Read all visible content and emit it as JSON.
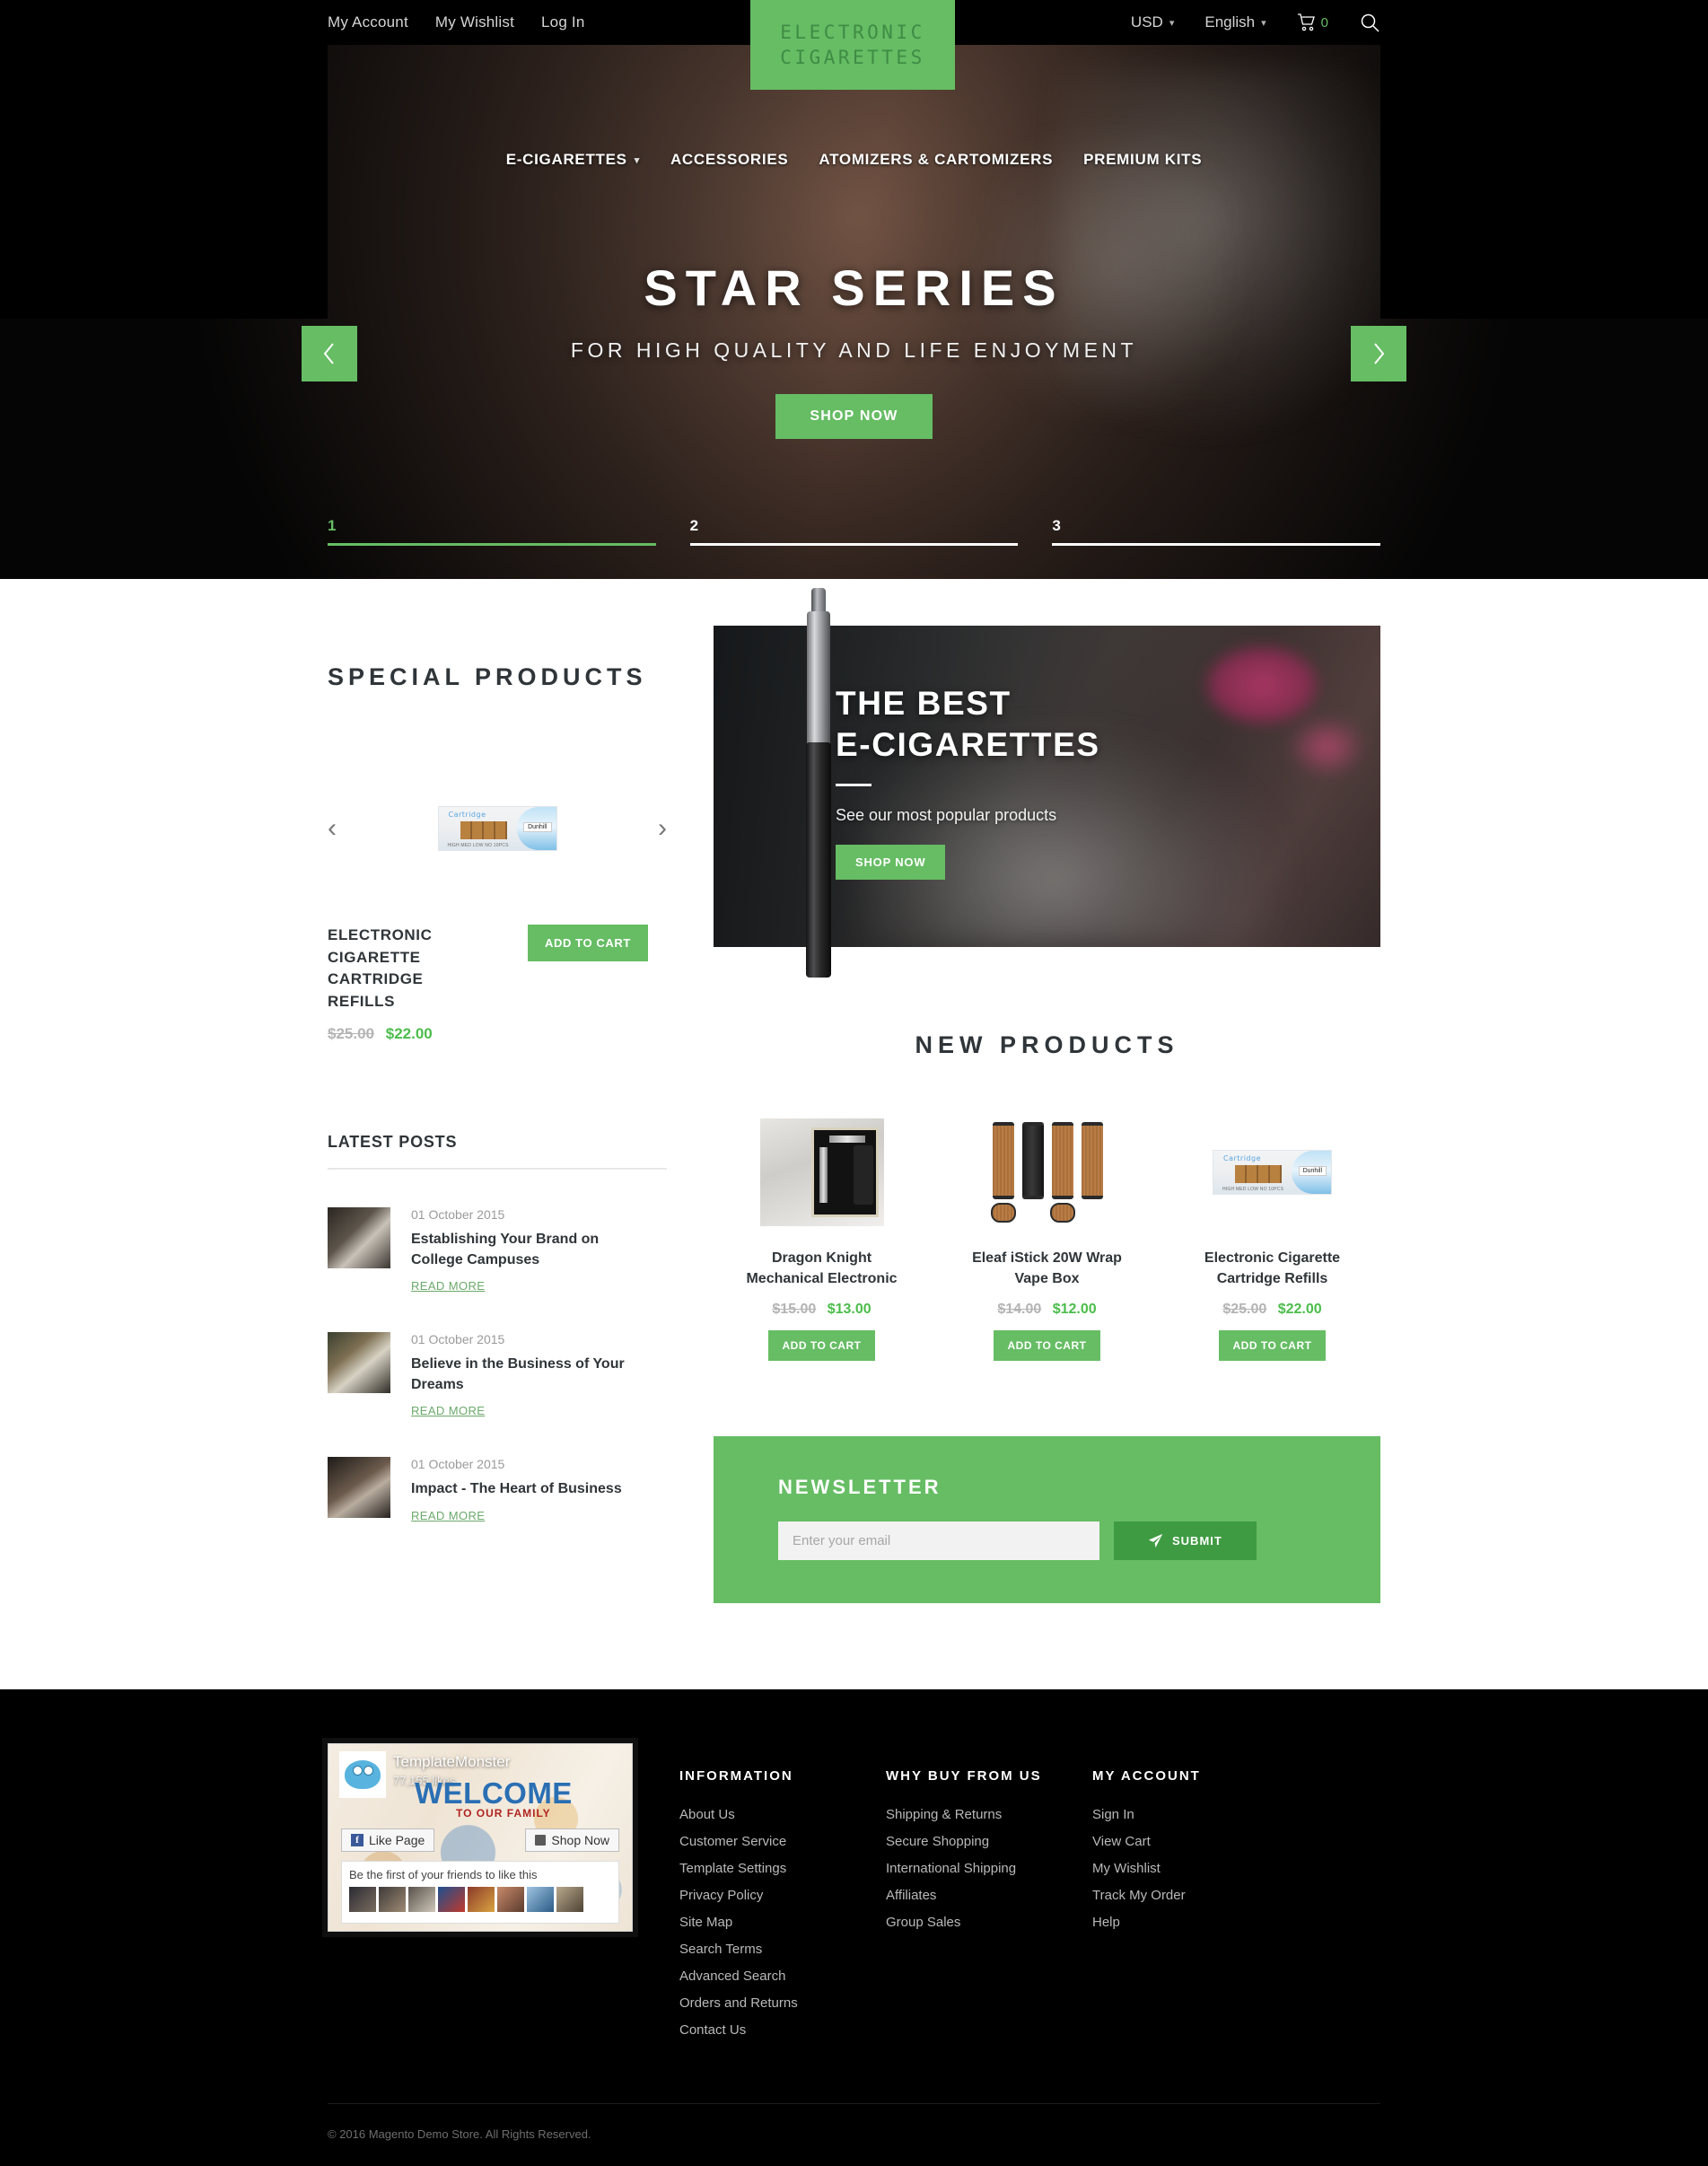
{
  "topbar": {
    "links": [
      {
        "label": "My Account"
      },
      {
        "label": "My Wishlist"
      },
      {
        "label": "Log In"
      }
    ],
    "currency": "USD",
    "language": "English",
    "cart_count": "0"
  },
  "logo": {
    "line1": "ELECTRONIC",
    "line2": "CIGARETTES"
  },
  "mainnav": [
    {
      "label": "E-CIGARETTES",
      "has_dropdown": true
    },
    {
      "label": "ACCESSORIES",
      "has_dropdown": false
    },
    {
      "label": "ATOMIZERS & CARTOMIZERS",
      "has_dropdown": false
    },
    {
      "label": "PREMIUM KITS",
      "has_dropdown": false
    }
  ],
  "hero": {
    "title": "STAR SERIES",
    "subtitle": "FOR HIGH QUALITY AND LIFE ENJOYMENT",
    "cta": "SHOP NOW",
    "slides": [
      {
        "num": "1",
        "active": true
      },
      {
        "num": "2",
        "active": false
      },
      {
        "num": "3",
        "active": false
      }
    ]
  },
  "special_products": {
    "heading": "SPECIAL PRODUCTS",
    "product": {
      "name": "ELECTRONIC CIGARETTE CARTRIDGE REFILLS",
      "price_old": "$25.00",
      "price_new": "$22.00",
      "cta": "ADD TO CART",
      "image_label": "Cartridge",
      "image_brand": "Dunhill",
      "image_options": "HIGH MED LOW NO 10PCS"
    }
  },
  "latest_posts": {
    "heading": "LATEST POSTS",
    "read_more": "READ MORE",
    "posts": [
      {
        "date": "01 October 2015",
        "title": "Establishing Your Brand on College Campuses"
      },
      {
        "date": "01 October 2015",
        "title": "Believe in the Business of Your Dreams"
      },
      {
        "date": "01 October 2015",
        "title": "Impact - The Heart of Business"
      }
    ]
  },
  "promo": {
    "line1": "THE BEST",
    "line2": "E-CIGARETTES",
    "text": "See our most popular products",
    "cta": "SHOP NOW"
  },
  "new_products": {
    "heading": "NEW PRODUCTS",
    "items": [
      {
        "name": "Dragon Knight Mechanical Electronic",
        "price_old": "$15.00",
        "price_new": "$13.00",
        "cta": "ADD TO CART"
      },
      {
        "name": "Eleaf iStick 20W Wrap Vape Box",
        "price_old": "$14.00",
        "price_new": "$12.00",
        "cta": "ADD TO CART"
      },
      {
        "name": "Electronic Cigarette Cartridge Refills",
        "price_old": "$25.00",
        "price_new": "$22.00",
        "cta": "ADD TO CART"
      }
    ]
  },
  "newsletter": {
    "heading": "NEWSLETTER",
    "placeholder": "Enter your email",
    "submit": "SUBMIT"
  },
  "facebook": {
    "page_name": "TemplateMonster",
    "likes": "77,155 likes",
    "welcome": "WELCOME",
    "family": "TO OUR FAMILY",
    "like_button": "Like Page",
    "shop_button": "Shop Now",
    "friends_text": "Be the first of your friends to like this"
  },
  "footer": {
    "columns": [
      {
        "title": "INFORMATION",
        "links": [
          {
            "label": "About Us"
          },
          {
            "label": "Customer Service"
          },
          {
            "label": "Template Settings"
          },
          {
            "label": "Privacy Policy"
          },
          {
            "label": "Site Map"
          },
          {
            "label": "Search Terms"
          },
          {
            "label": "Advanced Search"
          },
          {
            "label": "Orders and Returns"
          },
          {
            "label": "Contact Us"
          }
        ]
      },
      {
        "title": "WHY BUY FROM US",
        "links": [
          {
            "label": "Shipping & Returns"
          },
          {
            "label": "Secure Shopping"
          },
          {
            "label": "International Shipping"
          },
          {
            "label": "Affiliates"
          },
          {
            "label": "Group Sales"
          }
        ]
      },
      {
        "title": "MY ACCOUNT",
        "links": [
          {
            "label": "Sign In"
          },
          {
            "label": "View Cart"
          },
          {
            "label": "My Wishlist"
          },
          {
            "label": "Track My Order"
          },
          {
            "label": "Help"
          }
        ]
      }
    ],
    "copyright": "© 2016 Magento Demo Store. All Rights Reserved."
  },
  "colors": {
    "accent_green": "#66bd64",
    "dark_green": "#3f9b42",
    "price_green": "#4bbd4b",
    "black": "#000000"
  }
}
